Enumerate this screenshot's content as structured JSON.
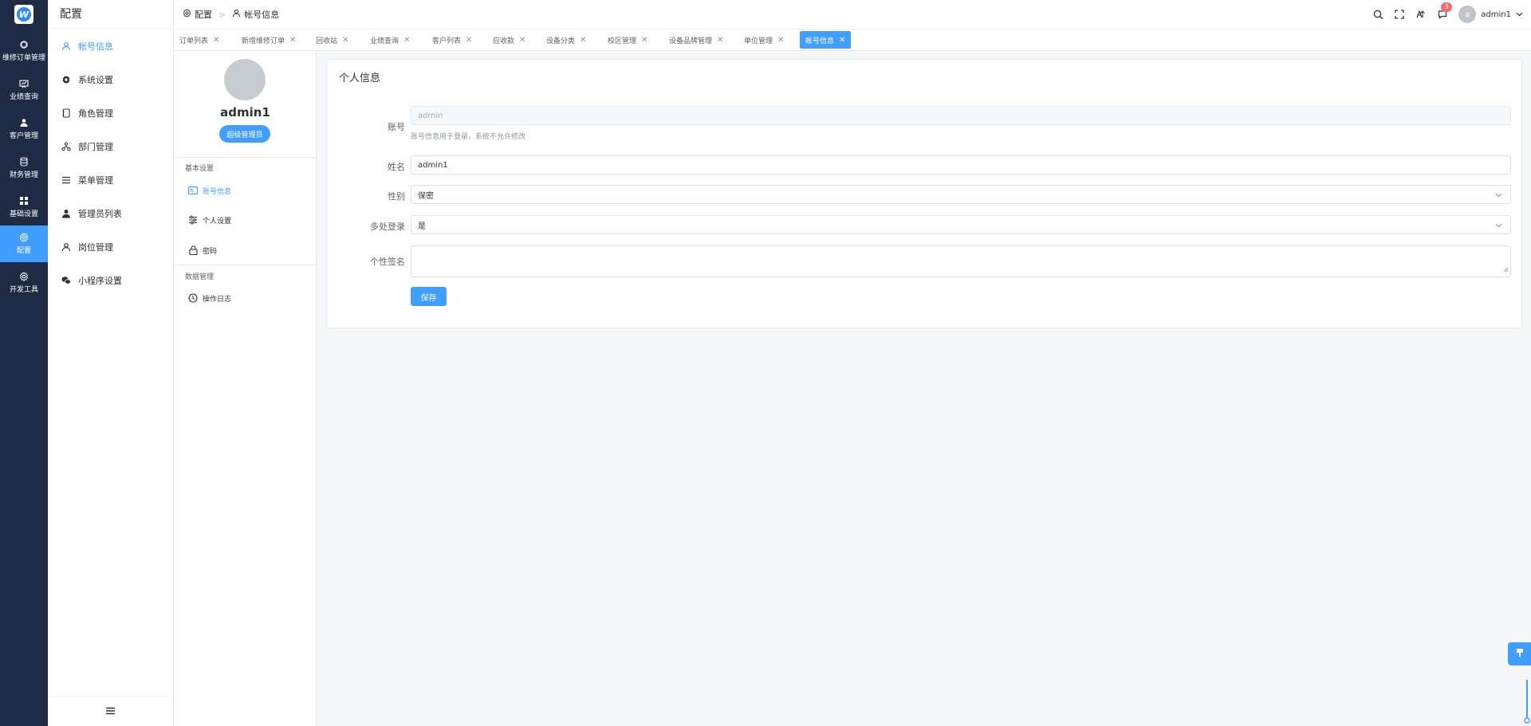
{
  "rail": {
    "logo_letter": "W",
    "items": [
      {
        "label": "维修订单管理",
        "icon": "chip-icon"
      },
      {
        "label": "业绩查询",
        "icon": "chart-board-icon"
      },
      {
        "label": "客户管理",
        "icon": "user-icon"
      },
      {
        "label": "财务管理",
        "icon": "database-icon"
      },
      {
        "label": "基础设置",
        "icon": "grid-icon"
      },
      {
        "label": "配置",
        "icon": "gear-icon",
        "active": true
      },
      {
        "label": "开发工具",
        "icon": "gear-icon"
      }
    ]
  },
  "menu": {
    "title": "配置",
    "items": [
      {
        "label": "帐号信息",
        "icon": "user-outline-icon",
        "active": true
      },
      {
        "label": "系统设置",
        "icon": "gear-icon"
      },
      {
        "label": "角色管理",
        "icon": "notebook-icon"
      },
      {
        "label": "部门管理",
        "icon": "org-icon"
      },
      {
        "label": "菜单管理",
        "icon": "list-icon"
      },
      {
        "label": "管理员列表",
        "icon": "user-solid-icon"
      },
      {
        "label": "岗位管理",
        "icon": "user-outline-icon"
      },
      {
        "label": "小程序设置",
        "icon": "wechat-icon"
      }
    ],
    "collapse_icon": "hamburger-icon"
  },
  "header": {
    "breadcrumb": [
      "配置",
      "帐号信息"
    ],
    "badge_count": "3",
    "username": "admin1",
    "avatar_letter": "a"
  },
  "tabs": [
    {
      "label": "订单列表"
    },
    {
      "label": "新增维修订单"
    },
    {
      "label": "回收站"
    },
    {
      "label": "业绩查询"
    },
    {
      "label": "客户列表"
    },
    {
      "label": "应收款"
    },
    {
      "label": "设备分类"
    },
    {
      "label": "校区管理"
    },
    {
      "label": "设备品牌管理"
    },
    {
      "label": "单位管理"
    },
    {
      "label": "帐号信息",
      "active": true
    }
  ],
  "profile": {
    "name": "admin1",
    "role": "超级管理员",
    "group_basic": "基本设置",
    "group_data": "数据管理",
    "items": {
      "account": "账号信息",
      "personal": "个人设置",
      "password": "密码",
      "oplog": "操作日志"
    }
  },
  "form": {
    "title": "个人信息",
    "account_label": "账号",
    "account_value": "admin",
    "account_hint": "账号信息用于登录，系统不允许修改",
    "name_label": "姓名",
    "name_value": "admin1",
    "gender_label": "性别",
    "gender_value": "保密",
    "multi_login_label": "多处登录",
    "multi_login_value": "是",
    "signature_label": "个性签名",
    "signature_value": "",
    "save_label": "保存"
  },
  "colors": {
    "primary": "#409eff",
    "rail_bg": "#1f2b45",
    "badge": "#f56c6c"
  }
}
